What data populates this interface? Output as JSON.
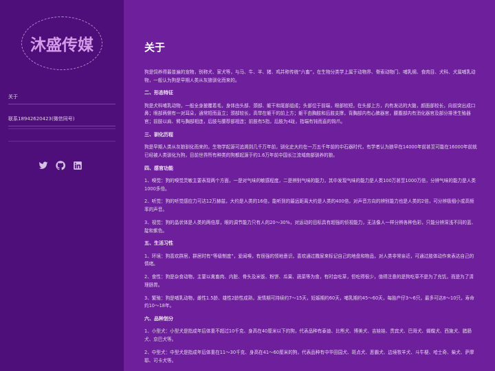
{
  "sidebar": {
    "logo_text": "沐盛传媒",
    "nav": {
      "about": "关于",
      "contact": "联系18942620423(微信同号)"
    },
    "social_icons": [
      "twitter-icon",
      "github-icon",
      "linkedin-icon"
    ]
  },
  "main": {
    "title": "关于",
    "intro": "狗是饲养得最普遍的宠物，别称犬、家犬等，与马、牛、羊、猪、鸡并称传统“六畜”，在生物分类学上属于动物界、脊索动物门、哺乳纲、食肉目、犬科、犬属哺乳动物，一般认为狗是早期人类从灰狼驯化而来的。",
    "sections": [
      {
        "heading": "二、形态特征",
        "paragraphs": [
          "狗是犬科哺乳动物，一般全身披覆着毛，身体由头部、颈部、躯干和尾部组成；头部位于前端，眼部较短，在头部上方，内有发达的大脑，颜面部较长，向前突出成口鼻；眼部两侧有一对耳朵，通常短而直立；颈部较长，高举在躯干的前上方；躯干由胸肢和后肢支撑，背胸部内有心脾器官，腰腹部内有消化器官及部分排泄生殖器官；前肢以肩、臂与胸部相连，后肢与腰荐部相连；前肢有5指，后肢为4趾，指端有钝而直的钩爪。"
        ]
      },
      {
        "heading": "三、驯化历程",
        "paragraphs": [
          "狗是早期人类从灰狼驯化而来的，生物学起源可追溯到几千万年前，驯化史大约在一万五千年前的中石器时代，有学者认为狼早在14000年前甚至可能在16000年前就已经被人类驯化为狗，目前世界所有种类的狗都起源于约1.6万年前中国长江流域南部驯养的狼。"
        ]
      },
      {
        "heading": "四、感官功能",
        "paragraphs": [
          "1、嗅觉：狗的嗅觉灵敏主要表现两个方面，一是对气味的敏感程度，二是辨别气味的能力，其中发现气味的能力是人类100万甚至1000万倍，分辨气味的能力是人类1000多倍。",
          "2、听觉：狗的听觉感应力可达12万赫兹，大约是人类的16倍，能听到的最远距离大约是人类的400倍，对声音方向的辨别能力也是人类的2倍，可分辨极细小或高频率的声音。",
          "3、视觉：狗的晶状体是人类的两倍厚，眼的调节能力只有人的20～30%，对运动的目标具有超强的侦视能力，无法像人一样分辨各种色彩，只能分辨深浅不同的蓝、靛和紫色。"
        ]
      },
      {
        "heading": "五、生活习性",
        "paragraphs": [
          "1、环境：狗喜欢群居，群居时有“等级制度”，爱闻嗅，有很强的领地意识，喜欢通过撒尿来标记自己的地盘和物品，对人类非常亲近，可通过肢体动作来表达自己的情绪。",
          "2、食性：狗是杂食动物，主要以禽畜肉、内脏、骨头及米饭、粉饼、瓜果、蔬菜等为食，有时会吃草，但吃得很少，值得注意的是狗吃草不是为了充饥，而是为了清理肠胃。",
          "3、繁殖：狗是哺乳动物，雌性1.5龄、雄性2龄性成熟，发情期可持续约7～15天，妊娠期约60天，哺乳期约45～60天，每胎产仔3～6只，最多可达8～10只，寿命约10～18年。"
        ]
      },
      {
        "heading": "六、品种划分",
        "paragraphs": [
          "1、小型犬：小型犬是指成年后体重不超过10千克、身高在40厘米以下的狗，代表品种有泰迪、比熊犬、博美犬、吉娃娃、贵宾犬、巴哥犬、蝴蝶犬、西施犬、腊肠犬、京巴犬等。",
          "2、中型犬：中型犬是指成年后体重在11～30千克、身高在41～60厘米的狗，代表品种有中华田园犬、斑点犬、恶霸犬、边境牧羊犬、斗牛梗、哈士奇、柴犬、萨摩耶、可卡犬等。"
        ]
      }
    ]
  }
}
